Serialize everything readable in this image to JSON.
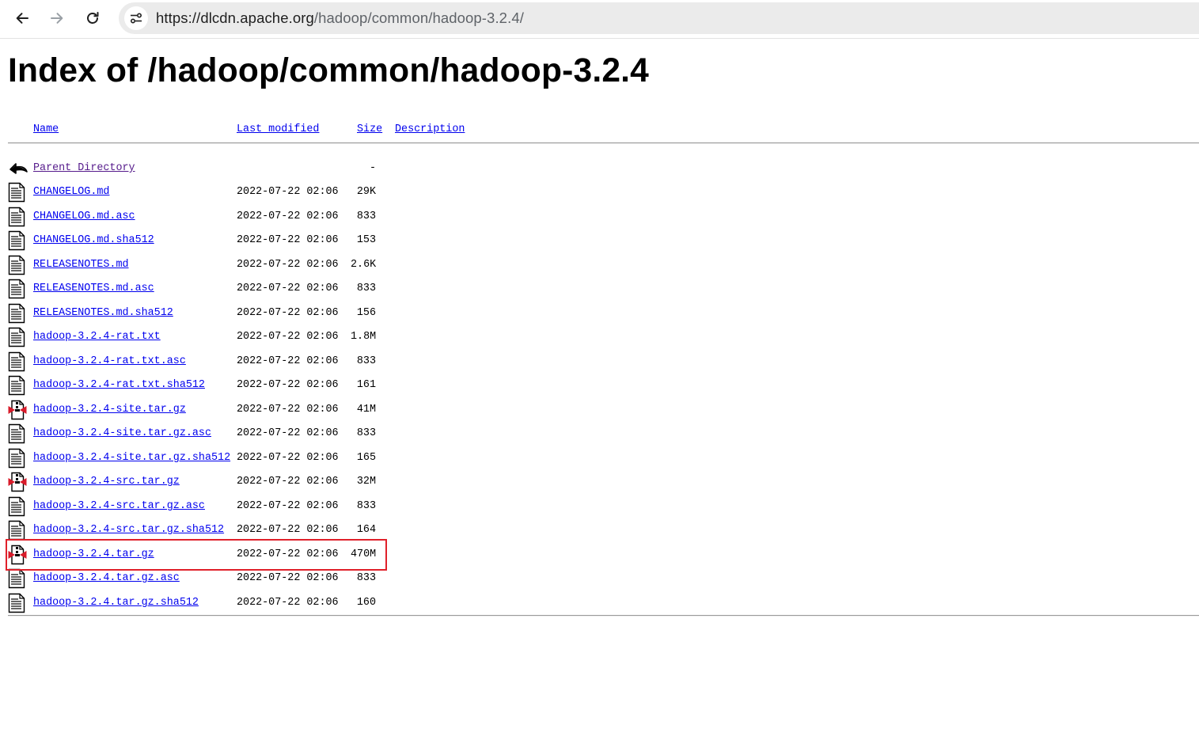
{
  "browser": {
    "url_host": "https://dlcdn.apache.org",
    "url_path": "/hadoop/common/hadoop-3.2.4/"
  },
  "page": {
    "title": "Index of /hadoop/common/hadoop-3.2.4"
  },
  "table": {
    "headers": {
      "name": "Name",
      "last_modified": "Last modified",
      "size": "Size",
      "description": "Description"
    },
    "parent": {
      "name": "Parent Directory",
      "size": "-",
      "icon": "back-icon"
    },
    "rows": [
      {
        "name": "CHANGELOG.md",
        "date": "2022-07-22 02:06",
        "size": "29K",
        "icon": "text-file-icon"
      },
      {
        "name": "CHANGELOG.md.asc",
        "date": "2022-07-22 02:06",
        "size": "833",
        "icon": "text-file-icon"
      },
      {
        "name": "CHANGELOG.md.sha512",
        "date": "2022-07-22 02:06",
        "size": "153",
        "icon": "text-file-icon"
      },
      {
        "name": "RELEASENOTES.md",
        "date": "2022-07-22 02:06",
        "size": "2.6K",
        "icon": "text-file-icon"
      },
      {
        "name": "RELEASENOTES.md.asc",
        "date": "2022-07-22 02:06",
        "size": "833",
        "icon": "text-file-icon"
      },
      {
        "name": "RELEASENOTES.md.sha512",
        "date": "2022-07-22 02:06",
        "size": "156",
        "icon": "text-file-icon"
      },
      {
        "name": "hadoop-3.2.4-rat.txt",
        "date": "2022-07-22 02:06",
        "size": "1.8M",
        "icon": "text-file-icon"
      },
      {
        "name": "hadoop-3.2.4-rat.txt.asc",
        "date": "2022-07-22 02:06",
        "size": "833",
        "icon": "text-file-icon"
      },
      {
        "name": "hadoop-3.2.4-rat.txt.sha512",
        "date": "2022-07-22 02:06",
        "size": "161",
        "icon": "text-file-icon"
      },
      {
        "name": "hadoop-3.2.4-site.tar.gz",
        "date": "2022-07-22 02:06",
        "size": "41M",
        "icon": "compressed-file-icon"
      },
      {
        "name": "hadoop-3.2.4-site.tar.gz.asc",
        "date": "2022-07-22 02:06",
        "size": "833",
        "icon": "text-file-icon"
      },
      {
        "name": "hadoop-3.2.4-site.tar.gz.sha512",
        "date": "2022-07-22 02:06",
        "size": "165",
        "icon": "text-file-icon"
      },
      {
        "name": "hadoop-3.2.4-src.tar.gz",
        "date": "2022-07-22 02:06",
        "size": "32M",
        "icon": "compressed-file-icon"
      },
      {
        "name": "hadoop-3.2.4-src.tar.gz.asc",
        "date": "2022-07-22 02:06",
        "size": "833",
        "icon": "text-file-icon"
      },
      {
        "name": "hadoop-3.2.4-src.tar.gz.sha512",
        "date": "2022-07-22 02:06",
        "size": "164",
        "icon": "text-file-icon"
      },
      {
        "name": "hadoop-3.2.4.tar.gz",
        "date": "2022-07-22 02:06",
        "size": "470M",
        "icon": "compressed-file-icon",
        "highlighted": true
      },
      {
        "name": "hadoop-3.2.4.tar.gz.asc",
        "date": "2022-07-22 02:06",
        "size": "833",
        "icon": "text-file-icon"
      },
      {
        "name": "hadoop-3.2.4.tar.gz.sha512",
        "date": "2022-07-22 02:06",
        "size": "160",
        "icon": "text-file-icon"
      }
    ]
  },
  "colors": {
    "link": "#0000ee",
    "visited_link": "#551a8b",
    "highlight_border": "#e0202a"
  }
}
